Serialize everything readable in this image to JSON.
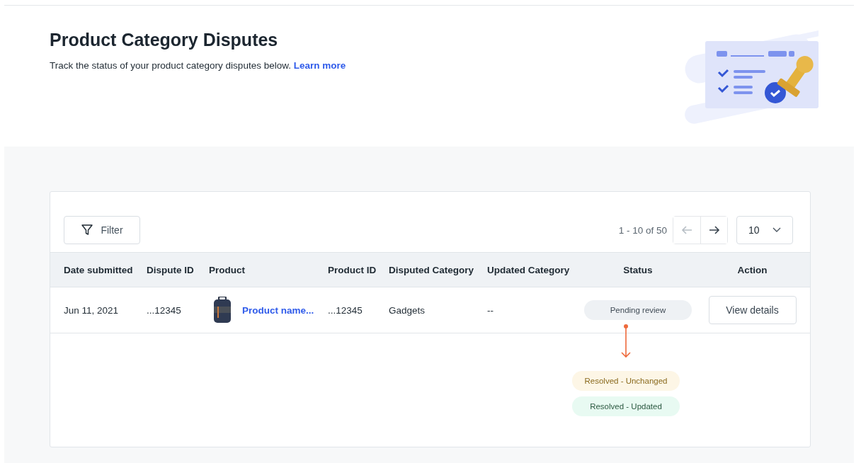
{
  "header": {
    "title": "Product Category Disputes",
    "description": "Track the status of your product category disputes below.",
    "link": "Learn more"
  },
  "toolbar": {
    "filter": "Filter",
    "range": "1 - 10 of 50",
    "prev_disabled": true,
    "next_disabled": false,
    "page_size": "10"
  },
  "table": {
    "columns": [
      "Date submitted",
      "Dispute ID",
      "Product",
      "Product ID",
      "Disputed Category",
      "Updated Category",
      "Status",
      "Action"
    ],
    "rows": [
      {
        "date": "Jun 11, 2021",
        "dispute_id": "...12345",
        "product": "Product name...",
        "product_id": "...12345",
        "disputed_category": "Gadgets",
        "updated_category": "--",
        "status": {
          "label": "Pending review",
          "kind": "pending"
        },
        "action": "View details"
      }
    ]
  },
  "status_outcomes": [
    {
      "label": "Resolved - Unchanged",
      "kind": "unchanged"
    },
    {
      "label": "Resolved - Updated",
      "kind": "updated"
    }
  ]
}
